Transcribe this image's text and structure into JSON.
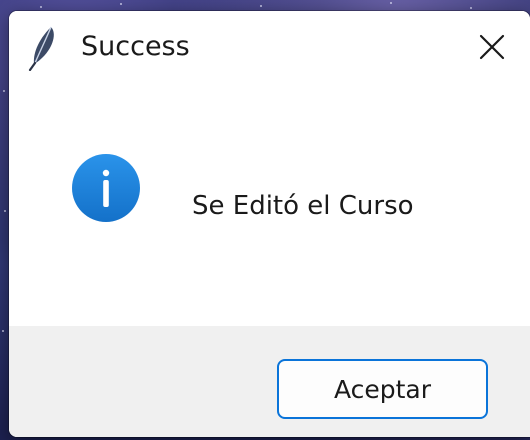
{
  "window": {
    "title": "Success",
    "app_icon": "feather-icon",
    "close_icon": "close-icon"
  },
  "message": {
    "icon": "info-icon",
    "text": "Se Editó el Curso",
    "icon_color": "#1e7fd6"
  },
  "buttons": {
    "ok_label": "Aceptar",
    "accent_color": "#0a74d9"
  }
}
